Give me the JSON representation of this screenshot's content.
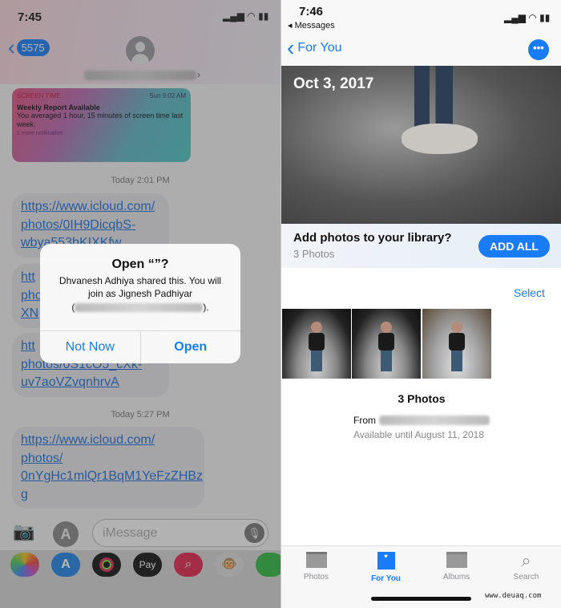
{
  "left": {
    "status": {
      "time": "7:45"
    },
    "nav": {
      "back_count": "5575"
    },
    "notification": {
      "app": "SCREEN TIME",
      "time": "Sun 9:02 AM",
      "title": "Weekly Report Available",
      "body": "You averaged 1 hour, 15 minutes of screen time last week.",
      "more": "1 more notification"
    },
    "timestamps": [
      "Today 2:01 PM",
      "Today 5:27 PM"
    ],
    "bubbles": [
      {
        "lines": [
          "https://www.icloud.com/",
          "photos/0IH9DicqbS-",
          "wbya553bKIXKfw"
        ]
      },
      {
        "lines": [
          "htt",
          "pho",
          "XN"
        ]
      },
      {
        "lines": [
          "htt",
          "photos/0S1cO5_cXk-",
          "uv7aoVZvqnhrvA"
        ]
      },
      {
        "lines": [
          "https://www.icloud.com/",
          "photos/",
          "0nYgHc1mlQr1BqM1YeFzZHBz",
          "g"
        ]
      }
    ],
    "input": {
      "placeholder": "iMessage"
    },
    "app_strip": [
      "photos-app",
      "app-store",
      "activity",
      "apple-pay",
      "search-images",
      "animoji",
      "clock"
    ],
    "apple_pay_label": "Pay",
    "alert": {
      "title": "Open “”?",
      "message_1": "Dhvanesh Adhiya shared this. You will",
      "message_2": "join as Jignesh Padhiyar",
      "paren_open": "(",
      "paren_close": ").",
      "not_now": "Not Now",
      "open": "Open"
    }
  },
  "right": {
    "status": {
      "time": "7:46",
      "back_app": "◂ Messages"
    },
    "nav": {
      "back": "For You"
    },
    "hero": {
      "date": "Oct 3, 2017"
    },
    "banner": {
      "title": "Add photos to your library?",
      "subtitle": "3 Photos",
      "button": "ADD ALL"
    },
    "select": "Select",
    "summary": {
      "count": "3 Photos",
      "from": "From",
      "available": "Available until August 11, 2018"
    },
    "tabs": [
      {
        "label": "Photos"
      },
      {
        "label": "For You",
        "active": true
      },
      {
        "label": "Albums"
      },
      {
        "label": "Search"
      }
    ],
    "watermark": "www.deuaq.com",
    "accent": "#1a7cf5"
  }
}
